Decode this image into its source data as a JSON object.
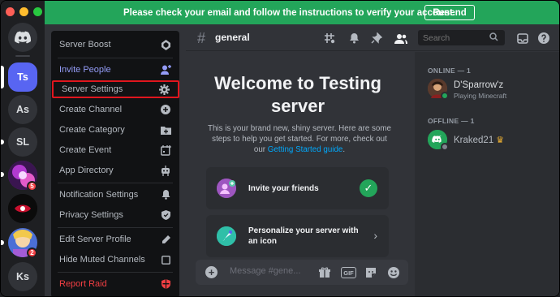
{
  "banner": {
    "message": "Please check your email and follow the instructions to verify your account.",
    "button": "Resend"
  },
  "servers": [
    {
      "label": "",
      "icon": "discord-logo-icon"
    },
    {
      "label": "Ts",
      "selected": true
    },
    {
      "label": "As"
    },
    {
      "label": "SL"
    },
    {
      "label": "",
      "icon": "server-avatar-icon",
      "badge": "5"
    },
    {
      "label": "",
      "icon": "server-avatar-icon"
    },
    {
      "label": "",
      "icon": "server-avatar-icon",
      "badge": "2"
    },
    {
      "label": "Ks"
    }
  ],
  "menu": {
    "items": [
      {
        "label": "Server Boost",
        "icon": "boost-icon"
      },
      {
        "label": "Invite People",
        "icon": "add-person-icon",
        "accent": true
      },
      {
        "label": "Server Settings",
        "icon": "gear-icon",
        "highlighted": true
      },
      {
        "label": "Create Channel",
        "icon": "plus-circle-icon"
      },
      {
        "label": "Create Category",
        "icon": "folder-plus-icon"
      },
      {
        "label": "Create Event",
        "icon": "calendar-plus-icon"
      },
      {
        "label": "App Directory",
        "icon": "robot-icon"
      },
      {
        "label": "Notification Settings",
        "icon": "bell-icon"
      },
      {
        "label": "Privacy Settings",
        "icon": "shield-icon"
      },
      {
        "label": "Edit Server Profile",
        "icon": "pencil-icon"
      },
      {
        "label": "Hide Muted Channels",
        "icon": "checkbox-icon"
      },
      {
        "label": "Report Raid",
        "icon": "shield-alert-icon",
        "danger": true
      }
    ]
  },
  "header": {
    "hash": "#",
    "channel": "general",
    "search_placeholder": "Search"
  },
  "welcome": {
    "title": "Welcome to Testing server",
    "desc_pre": "This is your brand new, shiny server. Here are some steps to help you get started. For more, check out our ",
    "desc_link": "Getting Started guide",
    "desc_post": ".",
    "cards": [
      {
        "label": "Invite your friends",
        "done": true
      },
      {
        "label": "Personalize your server with an icon",
        "done": false
      }
    ]
  },
  "composer": {
    "placeholder": "Message #gene...",
    "gif": "GIF"
  },
  "members": {
    "online_heading": "ONLINE — 1",
    "offline_heading": "OFFLINE — 1",
    "online": [
      {
        "name": "D'Sparrow'z",
        "activity": "Playing Minecraft",
        "status": "online"
      }
    ],
    "offline": [
      {
        "name": "Kraked21",
        "owner": true,
        "status": "offline"
      }
    ]
  },
  "colors": {
    "accent": "#5865f2",
    "banner": "#23a55a",
    "highlight_box": "#e0161e",
    "danger": "#f23f43"
  }
}
